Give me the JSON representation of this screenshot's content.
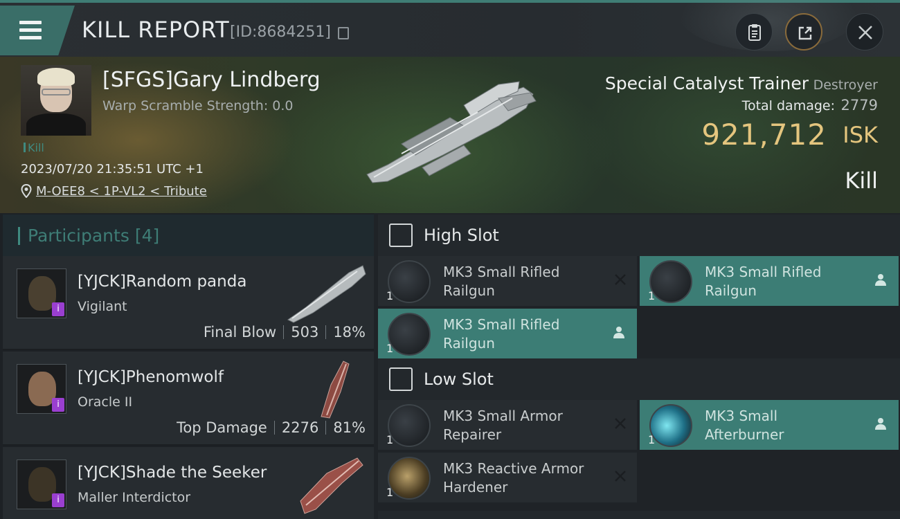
{
  "header": {
    "title": "KILL REPORT",
    "id_text": "[ID:8684251]"
  },
  "victim": {
    "name": "[SFGS]Gary Lindberg",
    "warp_scramble": "Warp Scramble Strength: 0.0",
    "tag": "Kill",
    "datetime": "2023/07/20 21:35:51 UTC +1",
    "location": "M-OEE8 < 1P-VL2 < Tribute",
    "ship_name": "Special Catalyst Trainer",
    "ship_class": "Destroyer",
    "total_damage_label": "Total damage:",
    "total_damage": "2779",
    "isk_value": "921,712",
    "isk_unit": "ISK",
    "result": "Kill"
  },
  "participants": {
    "title": "Participants",
    "count": "[4]",
    "items": [
      {
        "name": "[YJCK]Random panda",
        "ship": "Vigilant",
        "label": "Final Blow",
        "damage": "503",
        "percent": "18%"
      },
      {
        "name": "[YJCK]Phenomwolf",
        "ship": "Oracle II",
        "label": "Top Damage",
        "damage": "2276",
        "percent": "81%"
      },
      {
        "name": "[YJCK]Shade the Seeker",
        "ship": "Maller Interdictor"
      }
    ]
  },
  "fitting": {
    "high_slot": {
      "title": "High Slot",
      "modules": [
        {
          "name_line1": "MK3 Small Rifled",
          "name_line2": "Railgun",
          "qty": "1",
          "state": "destroyed"
        },
        {
          "name_line1": "MK3 Small Rifled",
          "name_line2": "Railgun",
          "qty": "1",
          "state": "dropped"
        },
        {
          "name_line1": "MK3 Small Rifled",
          "name_line2": "Railgun",
          "qty": "1",
          "state": "dropped"
        }
      ]
    },
    "low_slot": {
      "title": "Low Slot",
      "modules": [
        {
          "name_line1": "MK3 Small Armor",
          "name_line2": "Repairer",
          "qty": "1",
          "state": "destroyed"
        },
        {
          "name_line1": "MK3 Small",
          "name_line2": "Afterburner",
          "qty": "1",
          "state": "dropped"
        },
        {
          "name_line1": "MK3 Reactive Armor",
          "name_line2": "Hardener",
          "qty": "1",
          "state": "destroyed"
        }
      ]
    }
  },
  "colors": {
    "accent_teal": "#3c7d75",
    "isk_gold": "#e4c57e",
    "badge_purple": "#9a3fd0"
  },
  "icons": [
    "menu-icon",
    "copy-icon",
    "clipboard-icon",
    "share-icon",
    "close-icon",
    "location-pin-icon",
    "slot-icon",
    "destroyed-x-icon",
    "person-icon"
  ]
}
